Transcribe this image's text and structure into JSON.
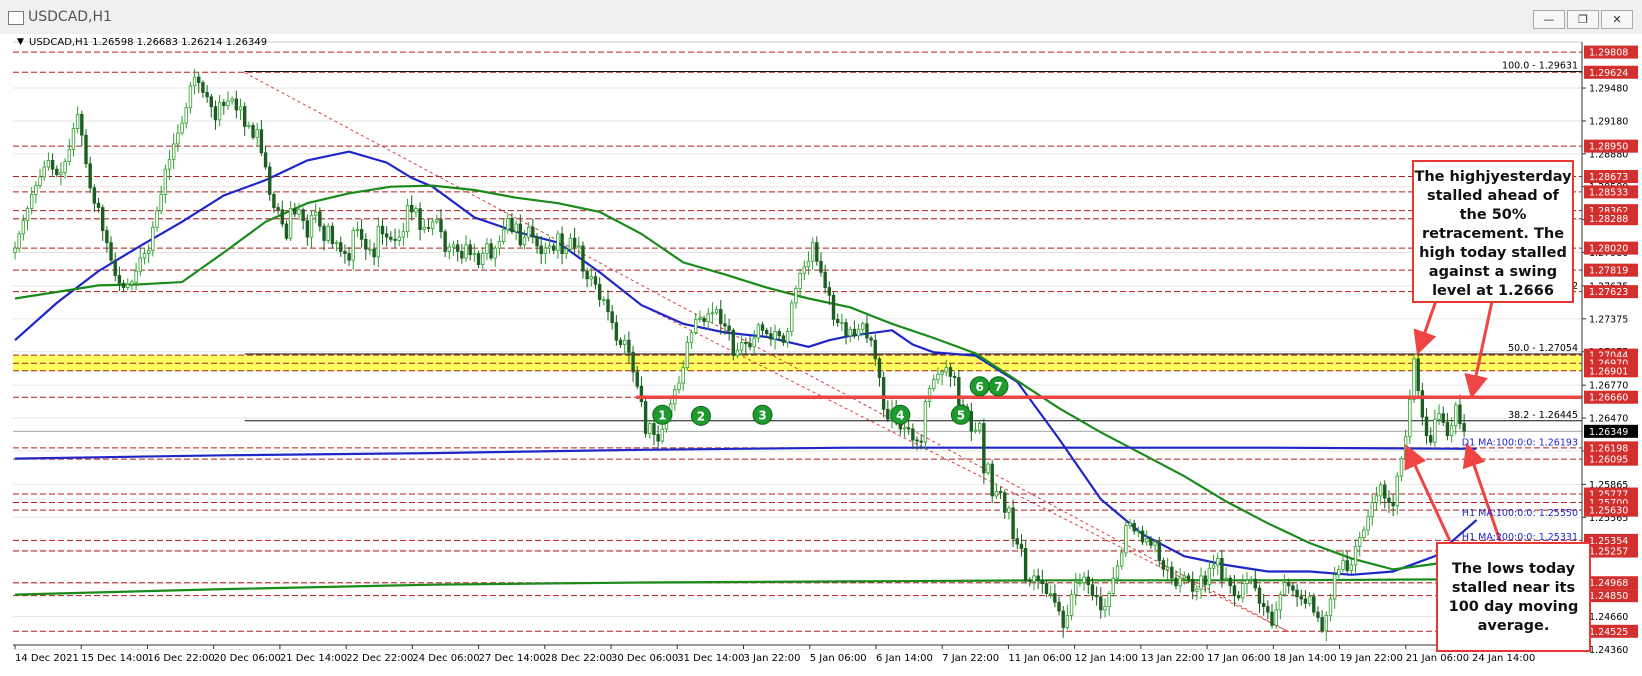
{
  "window": {
    "title": "USDCAD,H1",
    "buttons": [
      {
        "name": "minimize",
        "glyph": "—"
      },
      {
        "name": "restore",
        "glyph": "❐"
      },
      {
        "name": "close",
        "glyph": "✕"
      }
    ]
  },
  "chart_data": {
    "type": "candlestick",
    "symbol_line": "USDCAD,H1  1.26598 1.26683 1.26214 1.26349",
    "ylim": [
      1.244,
      1.299
    ],
    "x_labels": [
      "14 Dec 2021",
      "15 Dec 14:00",
      "16 Dec 22:00",
      "20 Dec 06:00",
      "21 Dec 14:00",
      "22 Dec 22:00",
      "24 Dec 06:00",
      "27 Dec 14:00",
      "28 Dec 22:00",
      "30 Dec 06:00",
      "31 Dec 14:00",
      "3 Jan 22:00",
      "5 Jan 06:00",
      "6 Jan 14:00",
      "7 Jan 22:00",
      "11 Jan 06:00",
      "12 Jan 14:00",
      "13 Jan 22:00",
      "17 Jan 06:00",
      "18 Jan 14:00",
      "19 Jan 22:00",
      "21 Jan 06:00",
      "24 Jan 14:00"
    ],
    "y_ticks": [
      "1.29480",
      "1.29180",
      "1.28880",
      "1.28580",
      "1.28280",
      "1.27980",
      "1.27675",
      "1.27375",
      "1.27075",
      "1.26770",
      "1.26470",
      "1.26170",
      "1.25865",
      "1.25565",
      "1.25265",
      "1.24960",
      "1.24660",
      "1.24360"
    ],
    "price_levels": [
      "1.29808",
      "1.29624",
      "1.28950",
      "1.28673",
      "1.28533",
      "1.28362",
      "1.28288",
      "1.28020",
      "1.27819",
      "1.27623",
      "1.27044",
      "1.26970",
      "1.26901",
      "1.26660",
      "1.26198",
      "1.26095",
      "1.25777",
      "1.25700",
      "1.25630",
      "1.25354",
      "1.25257",
      "1.24968",
      "1.24850",
      "1.24525"
    ],
    "current_price": "1.26349",
    "fib_levels": [
      {
        "label": "100.0 - 1.29631",
        "value": 1.29631
      },
      {
        "label": "50.0 - 1.27054",
        "value": 1.27054
      },
      {
        "label": "38.2 - 1.26445",
        "value": 1.26445
      }
    ],
    "ma_labels": [
      {
        "label": "D1 MA:100:0:0: 1.26193",
        "value": 1.26193
      },
      {
        "label": "H1 MA:100:0:0: 1.25550",
        "value": 1.2555
      },
      {
        "label": "H1 MA:200:0:0: 1.25331",
        "value": 1.25331
      }
    ],
    "partial_label": "62",
    "swing_level": {
      "value": 1.2666
    },
    "swing_touch_labels": [
      "1",
      "2",
      "3",
      "4",
      "5",
      "6",
      "7"
    ],
    "series": [
      {
        "name": "",
        "kind": "candles",
        "x": [
          0,
          4,
          8,
          12,
          16,
          20,
          24,
          28,
          32,
          36,
          40,
          44,
          48,
          52,
          56,
          60,
          64,
          68,
          72,
          76,
          80,
          84,
          88,
          92,
          96,
          100,
          104,
          108,
          112,
          116,
          120,
          124,
          128,
          132,
          136,
          140,
          144,
          148,
          152,
          156,
          160,
          164,
          168,
          172,
          176,
          180,
          184,
          188,
          192,
          196,
          200,
          204,
          208,
          212,
          216,
          220,
          224,
          228,
          232,
          236,
          240,
          244,
          248,
          252,
          256,
          260,
          264,
          268,
          272,
          276,
          280,
          284,
          288,
          292,
          296,
          300,
          304,
          308,
          312,
          316,
          320,
          324,
          328,
          332,
          336,
          340,
          344,
          348,
          352,
          356,
          360,
          364,
          368,
          372,
          376,
          380,
          384,
          388,
          392,
          396,
          400,
          404,
          408,
          412,
          416,
          420,
          424,
          428,
          432,
          436,
          440,
          444,
          448,
          452,
          456,
          460,
          464,
          468,
          472,
          476,
          480,
          484,
          488,
          492,
          496,
          500,
          504,
          508,
          512,
          516,
          520,
          524,
          528,
          532,
          536,
          540,
          544,
          548,
          552,
          556,
          560,
          564,
          568,
          572,
          576,
          580,
          584,
          588,
          592,
          596,
          600,
          604,
          608,
          612,
          616,
          620,
          624,
          628,
          632,
          636,
          640,
          644,
          648,
          652,
          656,
          660,
          664,
          668,
          672,
          676,
          680,
          684,
          688,
          692,
          696,
          700,
          704,
          708,
          712,
          716,
          720,
          724,
          728,
          732,
          736,
          740,
          744,
          748,
          752,
          756,
          760,
          764,
          768,
          772,
          776,
          780,
          784,
          788,
          792,
          796,
          800,
          804,
          808,
          812,
          816,
          820,
          824,
          828,
          832,
          836,
          840,
          844,
          848,
          852,
          856,
          860,
          864,
          868,
          872,
          876,
          880,
          884,
          888,
          892,
          896,
          900,
          904,
          908,
          912,
          916,
          920,
          924,
          928,
          932,
          936,
          940,
          944,
          948,
          952,
          956,
          960,
          964,
          968,
          972,
          976,
          980,
          984,
          988,
          992,
          996,
          1000,
          1004,
          1008,
          1012,
          1016,
          1020,
          1024,
          1028,
          1032,
          1036,
          1040,
          1044,
          1048,
          1052,
          1056,
          1060,
          1064,
          1068,
          1072,
          1076,
          1080,
          1084,
          1088,
          1092,
          1096,
          1100,
          1104,
          1108,
          1112,
          1116,
          1120,
          1124,
          1128,
          1132,
          1136,
          1140,
          1144,
          1148,
          1152,
          1156,
          1160,
          1164,
          1168,
          1172,
          1176,
          1180,
          1184,
          1188,
          1192,
          1196,
          1200,
          1204,
          1208,
          1212,
          1216,
          1220,
          1224,
          1228,
          1232,
          1236,
          1240,
          1244,
          1248,
          1252,
          1256,
          1260,
          1264,
          1268,
          1272,
          1276,
          1280,
          1284,
          1288,
          1292,
          1296,
          1300,
          1304,
          1308,
          1312,
          1316,
          1320,
          1324,
          1328,
          1332,
          1336,
          1340,
          1344,
          1348,
          1352,
          1356,
          1360,
          1364,
          1368,
          1372,
          1376,
          1380,
          1384,
          1388,
          1392,
          1396,
          1400,
          1404,
          1408
        ],
        "close": [
          1.2802,
          1.2815,
          1.2827,
          1.2838,
          1.2851,
          1.2859,
          1.2867,
          1.2876,
          1.2882,
          1.2874,
          1.2869,
          1.2871,
          1.2881,
          1.2892,
          1.2911,
          1.2924,
          1.2905,
          1.2879,
          1.2857,
          1.2843,
          1.2839,
          1.2818,
          1.2807,
          1.2791,
          1.2777,
          1.277,
          1.2766,
          1.2769,
          1.2771,
          1.2781,
          1.2793,
          1.2797,
          1.28,
          1.2821,
          1.2836,
          1.2851,
          1.2874,
          1.2883,
          1.2897,
          1.2907,
          1.2916,
          1.293,
          1.295,
          1.2958,
          1.2953,
          1.2944,
          1.294,
          1.2931,
          1.2919,
          1.2935,
          1.2932,
          1.2936,
          1.2938,
          1.2928,
          1.2931,
          1.2913,
          1.2914,
          1.2903,
          1.291,
          1.2889,
          1.2876,
          1.2851,
          1.2839,
          1.2837,
          1.2824,
          1.2811,
          1.2838,
          1.2833,
          1.2837,
          1.2827,
          1.2812,
          1.2832,
          1.2835,
          1.2822,
          1.2809,
          1.2822,
          1.2806,
          1.2807,
          1.2799,
          1.2797,
          1.2791,
          1.2818,
          1.2819,
          1.281,
          1.2801,
          1.2801,
          1.2794,
          1.2822,
          1.2815,
          1.2812,
          1.281,
          1.2809,
          1.2812,
          1.2817,
          1.2841,
          1.2835,
          1.2838,
          1.2819,
          1.2821,
          1.282,
          1.2826,
          1.2828,
          1.2817,
          1.2799,
          1.2803,
          1.2805,
          1.2799,
          1.2793,
          1.2805,
          1.2796,
          1.2797,
          1.2787,
          1.2797,
          1.2806,
          1.2793,
          1.2802,
          1.2808,
          1.2819,
          1.2829,
          1.2817,
          1.2824,
          1.2805,
          1.2812,
          1.2821,
          1.2812,
          1.2804,
          1.2797,
          1.2802,
          1.2804,
          1.28,
          1.2815,
          1.2797,
          1.2801,
          1.2811,
          1.2803,
          1.2804,
          1.2781,
          1.2774,
          1.2776,
          1.2769,
          1.2755,
          1.2755,
          1.2744,
          1.2734,
          1.2718,
          1.2714,
          1.2718,
          1.2707,
          1.2689,
          1.2676,
          1.2662,
          1.2633,
          1.2642,
          1.2632,
          1.2626,
          1.2637,
          1.2648,
          1.266,
          1.2673,
          1.2679,
          1.2693,
          1.2716,
          1.2725,
          1.2737,
          1.2738,
          1.2735,
          1.2742,
          1.2743,
          1.2746,
          1.2733,
          1.2731,
          1.2727,
          1.2704,
          1.2709,
          1.2716,
          1.2715,
          1.2712,
          1.272,
          1.2732,
          1.2727,
          1.2724,
          1.2719,
          1.2726,
          1.2722,
          1.2716,
          1.2726,
          1.2752,
          1.2765,
          1.2779,
          1.2785,
          1.279,
          1.2807,
          1.279,
          1.278,
          1.2766,
          1.2759,
          1.2737,
          1.2734,
          1.2734,
          1.2722,
          1.2728,
          1.2722,
          1.2728,
          1.2733,
          1.272,
          1.2718,
          1.2701,
          1.2684,
          1.2655,
          1.2646,
          1.2654,
          1.2644,
          1.2637,
          1.2638,
          1.2637,
          1.2627,
          1.2626,
          1.2625,
          1.2662,
          1.2674,
          1.2682,
          1.2687,
          1.2689,
          1.2693,
          1.2685,
          1.2684,
          1.2659,
          1.2657,
          1.2653,
          1.2635,
          1.2636,
          1.2642,
          1.2597,
          1.2605,
          1.2576,
          1.258,
          1.2579,
          1.2561,
          1.2565,
          1.2537,
          1.2532,
          1.2528,
          1.2499,
          1.2498,
          1.2503,
          1.2499,
          1.2496,
          1.2487,
          1.2487,
          1.2479,
          1.2471,
          1.2456,
          1.2467,
          1.2486,
          1.2497,
          1.2497,
          1.2502,
          1.2495,
          1.2485,
          1.2484,
          1.2472,
          1.2475,
          1.2487,
          1.2501,
          1.2512,
          1.2524,
          1.2549,
          1.2551,
          1.2544,
          1.2544,
          1.2534,
          1.2537,
          1.2531,
          1.2534,
          1.2517,
          1.2509,
          1.2511,
          1.2501,
          1.2494,
          1.2501,
          1.2503,
          1.25,
          1.2489,
          1.2491,
          1.2503,
          1.2495,
          1.251,
          1.2513,
          1.2519,
          1.25,
          1.2501,
          1.2494,
          1.2485,
          1.2483,
          1.2496,
          1.2499,
          1.25,
          1.2492,
          1.2478,
          1.2475,
          1.247,
          1.2458,
          1.2472,
          1.2486,
          1.2497,
          1.2494,
          1.249,
          1.2484,
          1.2482,
          1.2478,
          1.2484,
          1.247,
          1.2465,
          1.2453,
          1.2467,
          1.2482,
          1.2504,
          1.2509,
          1.2517,
          1.2508,
          1.2513,
          1.253,
          1.2538,
          1.2545,
          1.2557,
          1.257,
          1.2576,
          1.2586,
          1.2574,
          1.257,
          1.2567,
          1.2594,
          1.261,
          1.263,
          1.2664,
          1.2701,
          1.2672,
          1.2648,
          1.2631,
          1.2625,
          1.2646,
          1.2651,
          1.2643,
          1.2631,
          1.264,
          1.2659,
          1.2642,
          1.2635
        ]
      },
      {
        "name": "",
        "kind": "ma",
        "color": "#1f26c8",
        "x": [
          0,
          40,
          80,
          120,
          160,
          200,
          240,
          280,
          320,
          356,
          380,
          400,
          440,
          480,
          520,
          560,
          600,
          640,
          680,
          720,
          760,
          780,
          800,
          840,
          860,
          880,
          920,
          960,
          1000,
          1040,
          1080,
          1120,
          1160,
          1200,
          1240,
          1280,
          1320,
          1360,
          1400
        ],
        "y": [
          1.2718,
          1.2752,
          1.2781,
          1.2804,
          1.2826,
          1.285,
          1.2864,
          1.2882,
          1.289,
          1.288,
          1.2866,
          1.2858,
          1.283,
          1.2817,
          1.2807,
          1.278,
          1.275,
          1.2733,
          1.2725,
          1.2721,
          1.2712,
          1.2718,
          1.2722,
          1.2727,
          1.2714,
          1.2707,
          1.2704,
          1.268,
          1.2628,
          1.2573,
          1.2541,
          1.2521,
          1.2513,
          1.2507,
          1.2507,
          1.2504,
          1.2507,
          1.2521,
          1.2554
        ]
      },
      {
        "name": "",
        "kind": "ma",
        "color": "#1a8a1a",
        "x": [
          0,
          40,
          80,
          120,
          160,
          200,
          240,
          280,
          320,
          360,
          400,
          440,
          480,
          520,
          560,
          600,
          640,
          680,
          720,
          760,
          800,
          840,
          880,
          920,
          960,
          1000,
          1040,
          1080,
          1120,
          1160,
          1200,
          1240,
          1280,
          1320,
          1360,
          1400
        ],
        "y": [
          1.2756,
          1.2762,
          1.2768,
          1.2769,
          1.2771,
          1.2798,
          1.2826,
          1.2843,
          1.2852,
          1.2858,
          1.2859,
          1.2855,
          1.2848,
          1.2843,
          1.2835,
          1.2815,
          1.2789,
          1.2778,
          1.2766,
          1.2756,
          1.2748,
          1.2733,
          1.272,
          1.2706,
          1.2681,
          1.2656,
          1.2634,
          1.2614,
          1.2594,
          1.2571,
          1.2551,
          1.2533,
          1.2519,
          1.2509,
          1.2514,
          1.2533
        ]
      },
      {
        "name": "",
        "kind": "ma",
        "color": "#1f26c8",
        "x": [
          0,
          200,
          400,
          600,
          800,
          1000,
          1200,
          1400
        ],
        "y": [
          1.261,
          1.2613,
          1.2615,
          1.2618,
          1.262,
          1.262,
          1.262,
          1.2619
        ]
      },
      {
        "name": "",
        "kind": "ma",
        "color": "#1a8a1a",
        "x": [
          0,
          200,
          400,
          600,
          800,
          1000,
          1200,
          1400
        ],
        "y": [
          1.2486,
          1.2491,
          1.2495,
          1.2497,
          1.2498,
          1.2499,
          1.2499,
          1.25
        ]
      }
    ]
  },
  "annotations": {
    "top_callout": "The highjyesterday stalled ahead of the 50% retracement. The high today stalled against a swing  level at 1.2666",
    "bottom_callout": "The lows today stalled near its 100 day moving average."
  }
}
